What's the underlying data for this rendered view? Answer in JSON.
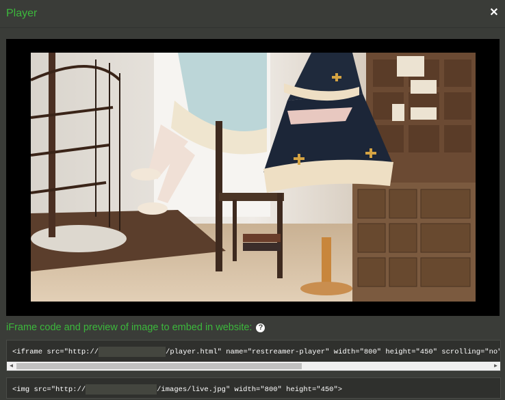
{
  "modal": {
    "title": "Player",
    "close_icon": "close-icon"
  },
  "player": {
    "preview_alt": "live-image"
  },
  "embed": {
    "label": "iFrame code and preview of image to embed in website:",
    "help_icon": "?",
    "iframe_code": {
      "before": "<iframe src=\"http://",
      "after": "/player.html\" name=\"restreamer-player\" width=\"800\" height=\"450\" scrolling=\"no\" frameborder=\""
    },
    "img_code": {
      "before": "<img src=\"http://",
      "after": "/images/live.jpg\" width=\"800\" height=\"450\">"
    }
  },
  "colors": {
    "accent": "#3cb83c",
    "background": "#3a3c38",
    "code_bg": "#2f302d"
  }
}
